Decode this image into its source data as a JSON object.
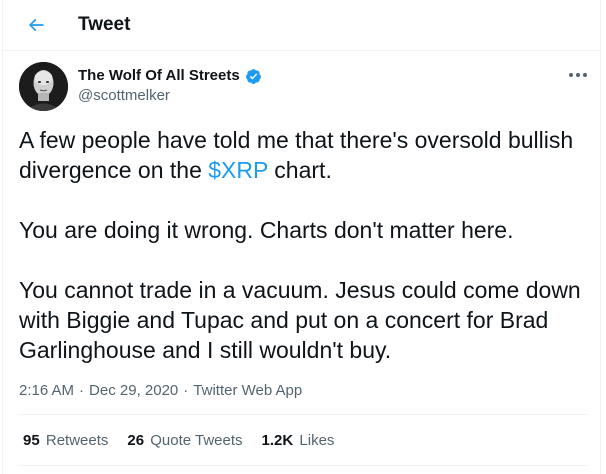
{
  "header": {
    "title": "Tweet"
  },
  "author": {
    "name": "The Wolf Of All Streets",
    "handle": "@scottmelker",
    "verified": true
  },
  "tweet": {
    "p1_before": "A few people have told me that there's oversold bullish divergence on the ",
    "p1_cashtag": "$XRP",
    "p1_after": " chart.",
    "p2": "You are doing it wrong. Charts don't matter here.",
    "p3": "You cannot trade in a vacuum. Jesus could come down with Biggie and Tupac and put on a concert for Brad Garlinghouse and I still wouldn't buy."
  },
  "meta": {
    "time": "2:16 AM",
    "date": "Dec 29, 2020",
    "source": "Twitter Web App",
    "separator": "·"
  },
  "stats": {
    "retweets_count": "95",
    "retweets_label": "Retweets",
    "quotes_count": "26",
    "quotes_label": "Quote Tweets",
    "likes_count": "1.2K",
    "likes_label": "Likes"
  },
  "colors": {
    "accent": "#1d9bf0",
    "secondary_text": "#536471",
    "divider": "#eff3f4"
  },
  "icons": {
    "back": "arrow-left-icon",
    "verified": "verified-badge-icon",
    "more": "more-dots-icon"
  }
}
